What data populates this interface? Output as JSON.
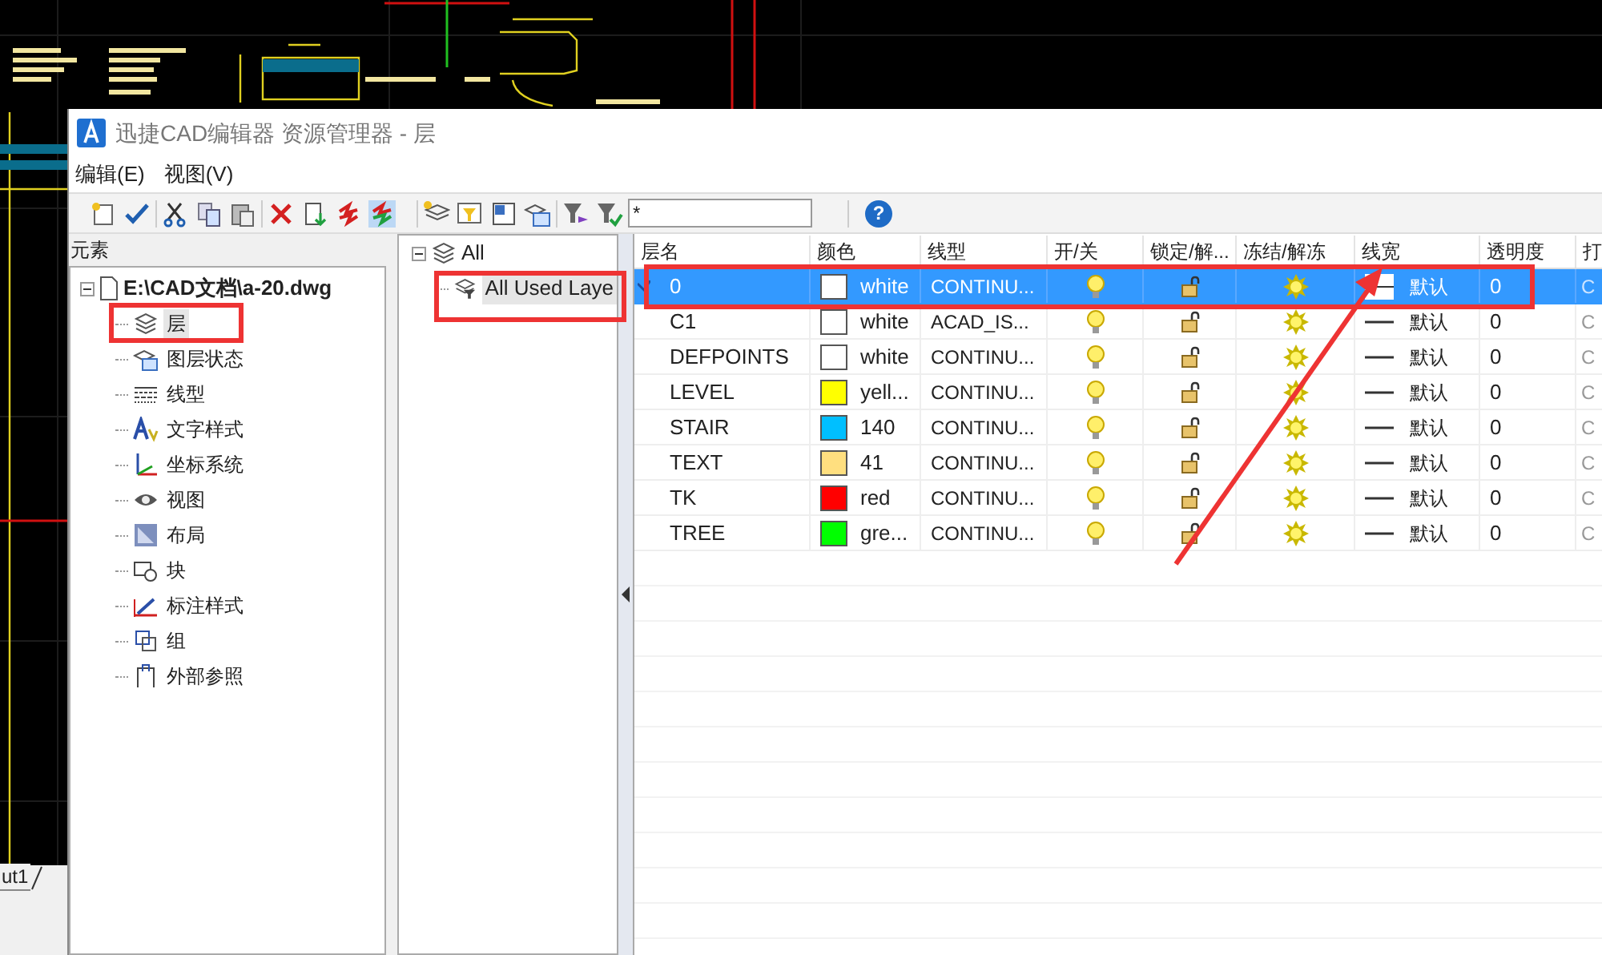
{
  "background": {
    "layout_tab": "ut1"
  },
  "window": {
    "title": "迅捷CAD编辑器 资源管理器 - 层"
  },
  "menu": [
    "编辑(E)",
    "视图(V)"
  ],
  "toolbar": {
    "filter_value": "*",
    "help": "?"
  },
  "elements_panel": {
    "title": "元素",
    "root": {
      "label": "E:\\CAD文档\\a-20.dwg",
      "expanded": true,
      "children": [
        {
          "label": "层",
          "kind": "layers",
          "selected": true
        },
        {
          "label": "图层状态",
          "kind": "layer-state",
          "selected": false
        },
        {
          "label": "线型",
          "kind": "linetype",
          "selected": false
        },
        {
          "label": "文字样式",
          "kind": "text-style",
          "selected": false
        },
        {
          "label": "坐标系统",
          "kind": "axes",
          "selected": false
        },
        {
          "label": "视图",
          "kind": "eye",
          "selected": false
        },
        {
          "label": "布局",
          "kind": "layout",
          "selected": false
        },
        {
          "label": "块",
          "kind": "block",
          "selected": false
        },
        {
          "label": "标注样式",
          "kind": "dimension",
          "selected": false
        },
        {
          "label": "组",
          "kind": "group",
          "selected": false
        },
        {
          "label": "外部参照",
          "kind": "xref",
          "selected": false
        }
      ]
    }
  },
  "filter_tree": {
    "root": {
      "label": "All",
      "expanded": true,
      "children": [
        {
          "label": "All Used Laye",
          "selected": true
        }
      ]
    }
  },
  "table": {
    "columns": [
      "层名",
      "颜色",
      "线型",
      "开/关",
      "锁定/解...",
      "冻结/解冻",
      "线宽",
      "透明度",
      "打"
    ],
    "rows": [
      {
        "name": "0",
        "color": "#ffffff",
        "color_name": "white",
        "linetype": "CONTINU...",
        "lineweight": "默认",
        "transparency": "0",
        "plot": "C",
        "selected": true
      },
      {
        "name": "C1",
        "color": "#ffffff",
        "color_name": "white",
        "linetype": "ACAD_IS...",
        "lineweight": "默认",
        "transparency": "0",
        "plot": "C",
        "selected": false
      },
      {
        "name": "DEFPOINTS",
        "color": "#ffffff",
        "color_name": "white",
        "linetype": "CONTINU...",
        "lineweight": "默认",
        "transparency": "0",
        "plot": "C",
        "selected": false
      },
      {
        "name": "LEVEL",
        "color": "#ffff00",
        "color_name": "yell...",
        "linetype": "CONTINU...",
        "lineweight": "默认",
        "transparency": "0",
        "plot": "C",
        "selected": false
      },
      {
        "name": "STAIR",
        "color": "#00bfff",
        "color_name": "140",
        "linetype": "CONTINU...",
        "lineweight": "默认",
        "transparency": "0",
        "plot": "C",
        "selected": false
      },
      {
        "name": "TEXT",
        "color": "#ffdf7f",
        "color_name": "41",
        "linetype": "CONTINU...",
        "lineweight": "默认",
        "transparency": "0",
        "plot": "C",
        "selected": false
      },
      {
        "name": "TK",
        "color": "#ff0000",
        "color_name": "red",
        "linetype": "CONTINU...",
        "lineweight": "默认",
        "transparency": "0",
        "plot": "C",
        "selected": false
      },
      {
        "name": "TREE",
        "color": "#00ff00",
        "color_name": "gre...",
        "linetype": "CONTINU...",
        "lineweight": "默认",
        "transparency": "0",
        "plot": "C",
        "selected": false
      }
    ]
  }
}
